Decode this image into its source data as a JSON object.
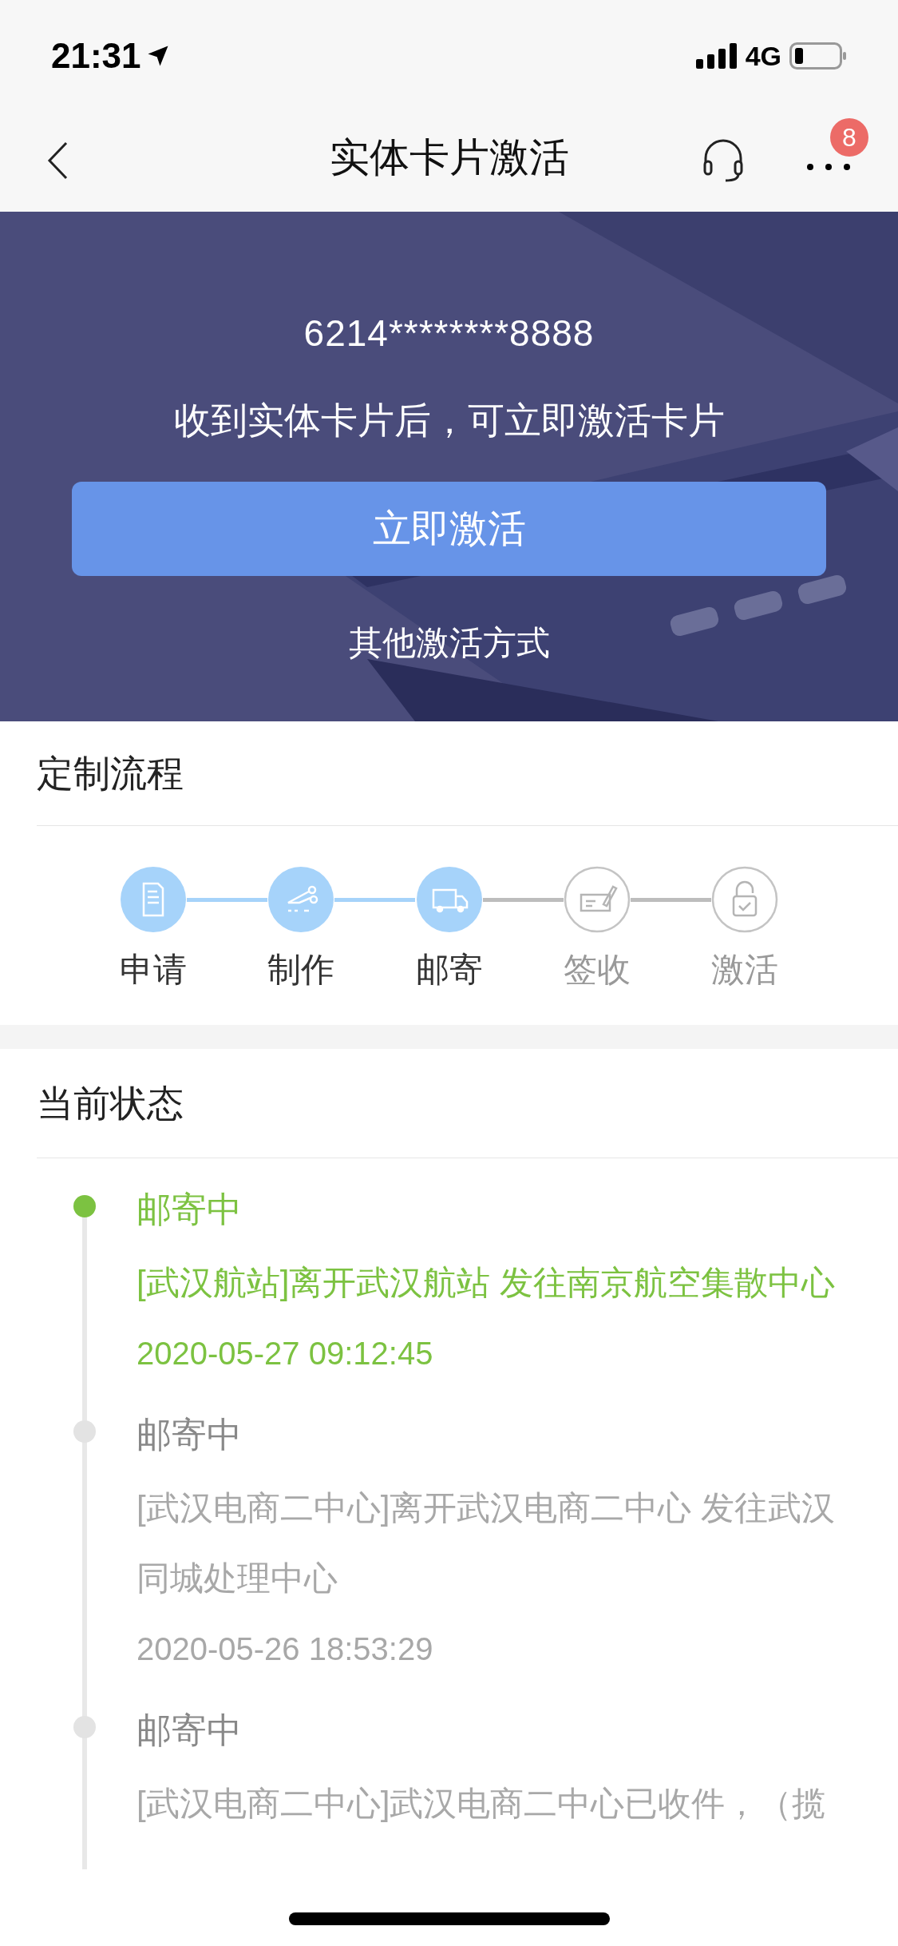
{
  "status_bar": {
    "time": "21:31",
    "network": "4G"
  },
  "header": {
    "title": "实体卡片激活",
    "badge": "8"
  },
  "banner": {
    "card_number": "6214********8888",
    "subtitle": "收到实体卡片后，可立即激活卡片",
    "primary_button": "立即激活",
    "secondary_link": "其他激活方式"
  },
  "process": {
    "title": "定制流程",
    "steps": [
      {
        "label": "申请",
        "kind": "document",
        "done": true
      },
      {
        "label": "制作",
        "kind": "scissors",
        "done": true
      },
      {
        "label": "邮寄",
        "kind": "truck",
        "done": true
      },
      {
        "label": "签收",
        "kind": "signature",
        "done": false
      },
      {
        "label": "激活",
        "kind": "lock",
        "done": false
      }
    ]
  },
  "status": {
    "title": "当前状态",
    "events": [
      {
        "title": "邮寄中",
        "detail": "[武汉航站]离开武汉航站 发往南京航空集散中心",
        "time": "2020-05-27 09:12:45",
        "current": true
      },
      {
        "title": "邮寄中",
        "detail": "[武汉电商二中心]离开武汉电商二中心 发往武汉同城处理中心",
        "time": "2020-05-26 18:53:29",
        "current": false
      },
      {
        "title": "邮寄中",
        "detail": "[武汉电商二中心]武汉电商二中心已收件，（揽",
        "current": false
      }
    ]
  }
}
